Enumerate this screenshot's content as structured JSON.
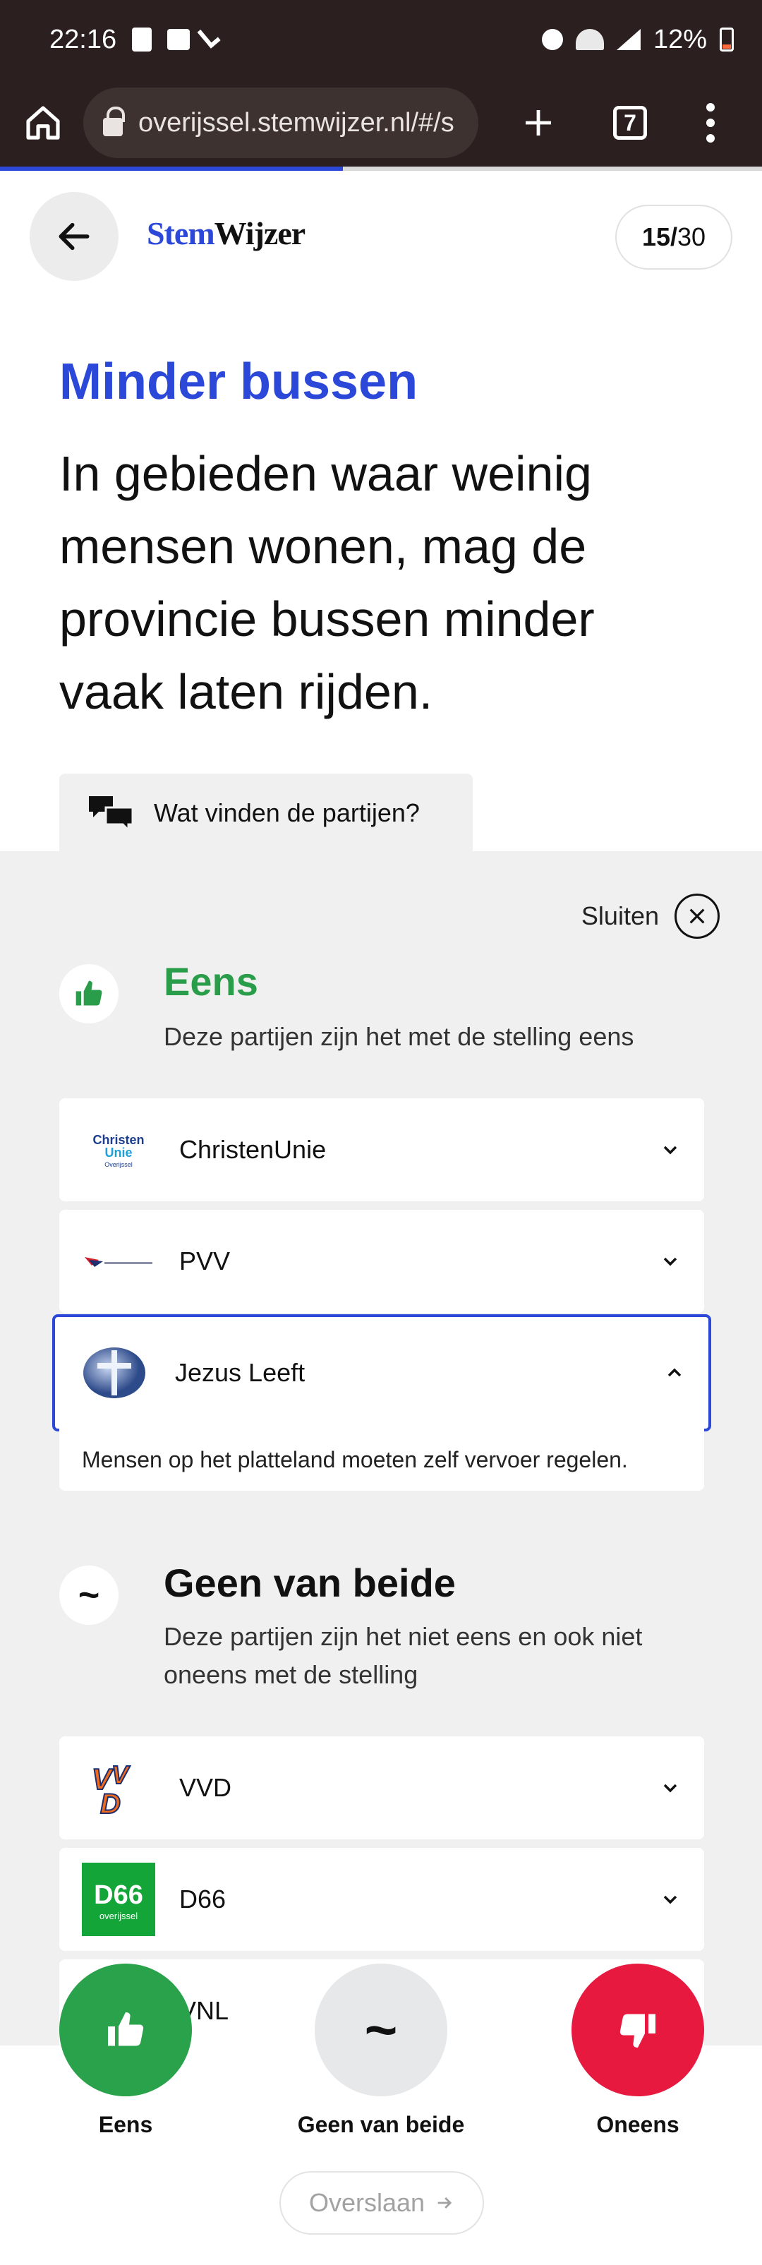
{
  "status_bar": {
    "time": "22:16",
    "battery_percent": "12%"
  },
  "browser": {
    "url": "overijssel.stemwijzer.nl/#/s",
    "tab_count": "7"
  },
  "progress": {
    "current": 15,
    "total": 30,
    "fraction": 0.45
  },
  "header": {
    "logo_part1": "Stem",
    "logo_part2": "Wijzer",
    "counter_current": "15/",
    "counter_total": "30"
  },
  "statement": {
    "title": "Minder bussen",
    "text": "In gebieden waar weinig mensen wonen, mag de provincie bussen minder vaak laten rijden."
  },
  "parties_tab": {
    "label": "Wat vinden de partijen?"
  },
  "panel": {
    "close_label": "Sluiten",
    "sections": {
      "agree": {
        "icon": "thumbs-up-icon",
        "symbol": "",
        "title": "Eens",
        "description": "Deze partijen zijn het met de stelling eens",
        "color": "#2a9d4a",
        "parties": [
          {
            "name": "ChristenUnie",
            "logo_text": "Christen",
            "logo_text2": "Unie",
            "logo_text3": "Overijssel"
          },
          {
            "name": "PVV",
            "logo_text": "PVV"
          },
          {
            "name": "Jezus Leeft",
            "logo_text": "JEZUS LEEFT",
            "expanded": true,
            "explanation": "Mensen op het platteland moeten zelf vervoer regelen."
          }
        ]
      },
      "neutral": {
        "symbol": "~",
        "title": "Geen van beide",
        "description": "Deze partijen zijn het niet eens en ook niet oneens met de stelling",
        "color": "#111111",
        "parties": [
          {
            "name": "VVD",
            "logo_text": "VVD"
          },
          {
            "name": "D66",
            "logo_text": "D66",
            "logo_sub": "overijssel"
          },
          {
            "name": "JA21/VNL",
            "visible_name": "VNL"
          }
        ]
      }
    }
  },
  "actions": {
    "agree_label": "Eens",
    "neutral_label": "Geen van beide",
    "neutral_symbol": "~",
    "disagree_label": "Oneens",
    "skip_label": "Overslaan",
    "colors": {
      "agree": "#2aa14b",
      "neutral": "#e7e8ea",
      "disagree": "#e8193f"
    }
  },
  "colors": {
    "brand": "#2b48d9",
    "panel_bg": "#f0f0f0"
  }
}
